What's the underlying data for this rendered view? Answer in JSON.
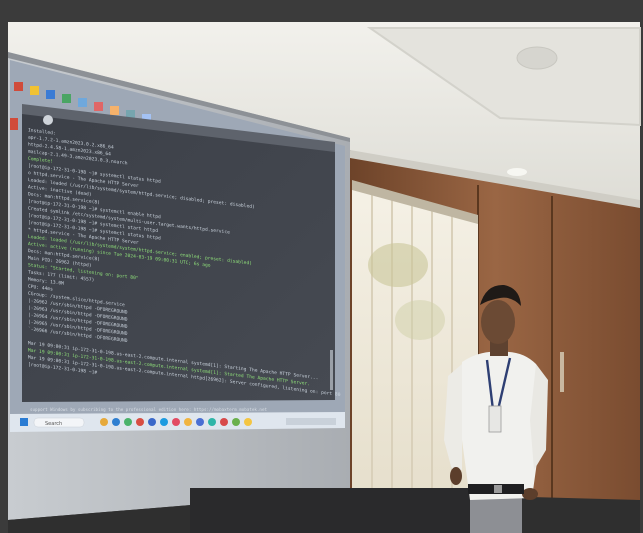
{
  "scene": {
    "description_tags": [
      "presentation-room",
      "projector-screen",
      "terminal-window",
      "speaker",
      "window-blinds",
      "wooden-panels"
    ],
    "colors": {
      "frame": "#3b3b3b",
      "ceiling": "#e9e8e2",
      "wall_wood": "#8a5b3c",
      "terminal_bg": "#3d4149",
      "terminal_text": "#c9d2dc",
      "terminal_green": "#8fe07a",
      "taskbar": "#dfe6ee",
      "shirt": "#f1f1ee",
      "skin": "#6b4a34"
    }
  },
  "terminal": {
    "lines": [
      "Installed:",
      "  apr-1.7.2-1.amzn2023.0.2.x86_64",
      "  httpd-2.4.58-1.amzn2023.x86_64",
      "  mailcap-2.1.49-3.amzn2023.0.3.noarch",
      "Complete!",
      "[root@ip-172-31-0-198 ~]# systemctl status httpd",
      "o httpd.service - The Apache HTTP Server",
      "   Loaded: loaded (/usr/lib/systemd/system/httpd.service; disabled; preset: disabled)",
      "   Active: inactive (dead)",
      "     Docs: man:httpd.service(8)",
      "[root@ip-172-31-0-198 ~]# systemctl enable httpd",
      "Created symlink /etc/systemd/system/multi-user.target.wants/httpd.service",
      "[root@ip-172-31-0-198 ~]# systemctl start httpd",
      "[root@ip-172-31-0-198 ~]# systemctl status httpd",
      "* httpd.service - The Apache HTTP Server",
      "   Loaded: loaded (/usr/lib/systemd/system/httpd.service; enabled; preset: disabled)",
      "   Active: active (running) since Tue 2024-03-19 09:00:31 UTC; 6s ago",
      "     Docs: man:httpd.service(8)",
      " Main PID: 26962 (httpd)",
      "   Status: \"Started, listening on: port 80\"",
      "    Tasks: 177 (limit: 4557)",
      "   Memory: 13.0M",
      "      CPU: 44ms",
      "   CGroup: /system.slice/httpd.service",
      "           |-26962 /usr/sbin/httpd -DFOREGROUND",
      "           |-26963 /usr/sbin/httpd -DFOREGROUND",
      "           |-26964 /usr/sbin/httpd -DFOREGROUND",
      "           |-26965 /usr/sbin/httpd -DFOREGROUND",
      "           `-26966 /usr/sbin/httpd -DFOREGROUND",
      "",
      "Mar 19 09:00:31 ip-172-31-0-198.us-east-2.compute.internal systemd[1]: Starting The Apache HTTP Server...",
      "Mar 19 09:00:31 ip-172-31-0-198.us-east-2.compute.internal systemd[1]: Started The Apache HTTP Server.",
      "Mar 19 09:00:31 ip-172-31-0-198.us-east-2.compute.internal httpd[26962]: Server configured, listening on: port 80",
      "[root@ip-172-31-0-198 ~]# "
    ],
    "status_line": "support Windows by subscribing to the professional edition here: https://mobaxterm.mobatek.net",
    "search_label": "Search"
  }
}
